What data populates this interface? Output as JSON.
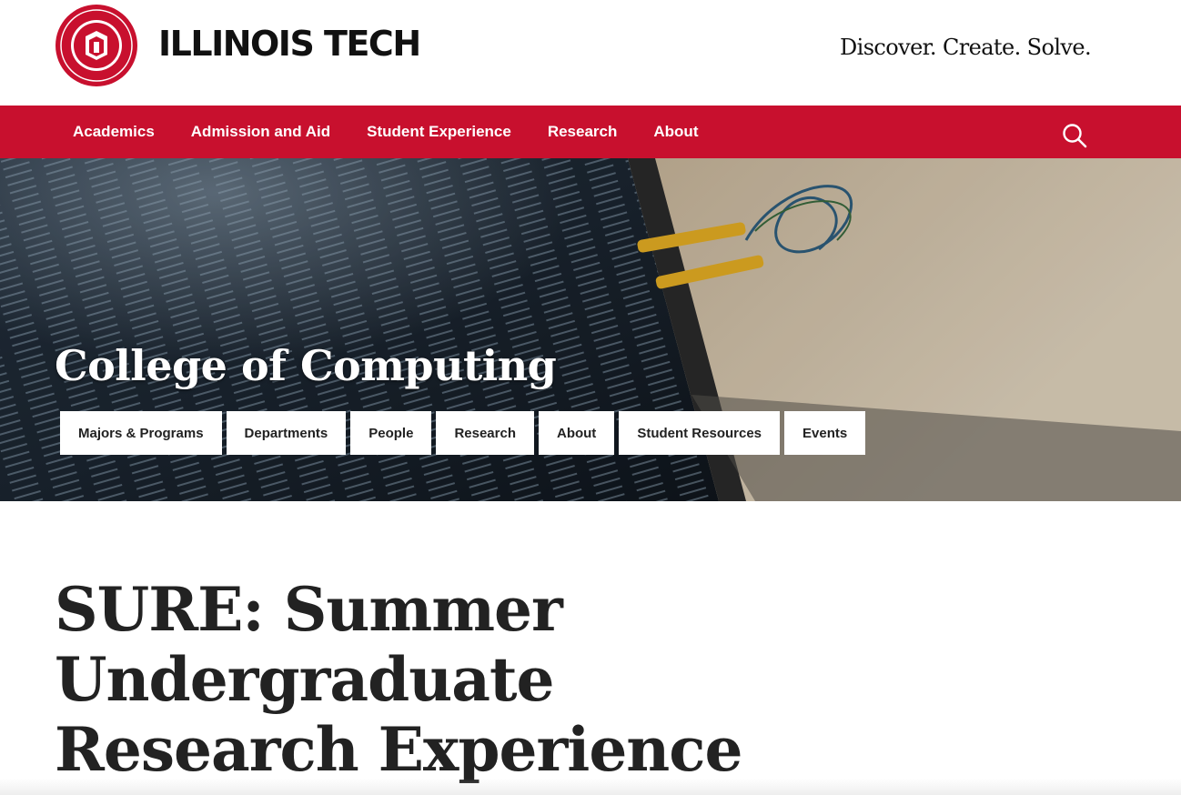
{
  "header": {
    "logo_name": "ILLINOIS TECH",
    "seal_text": "ILLINOIS INSTITUTE OF TECHNOLOGY 1890",
    "tagline": "Discover. Create. Solve."
  },
  "main_nav": {
    "items": [
      "Academics",
      "Admission and Aid",
      "Student Experience",
      "Research",
      "About"
    ],
    "search_icon": "search-icon"
  },
  "hero": {
    "title": "College of Computing",
    "tabs": [
      "Majors & Programs",
      "Departments",
      "People",
      "Research",
      "About",
      "Student Resources",
      "Events"
    ]
  },
  "main": {
    "page_title": "SURE: Summer Undergraduate Research Experience"
  },
  "colors": {
    "brand_red": "#c8102e",
    "text_dark": "#222222",
    "white": "#ffffff"
  }
}
